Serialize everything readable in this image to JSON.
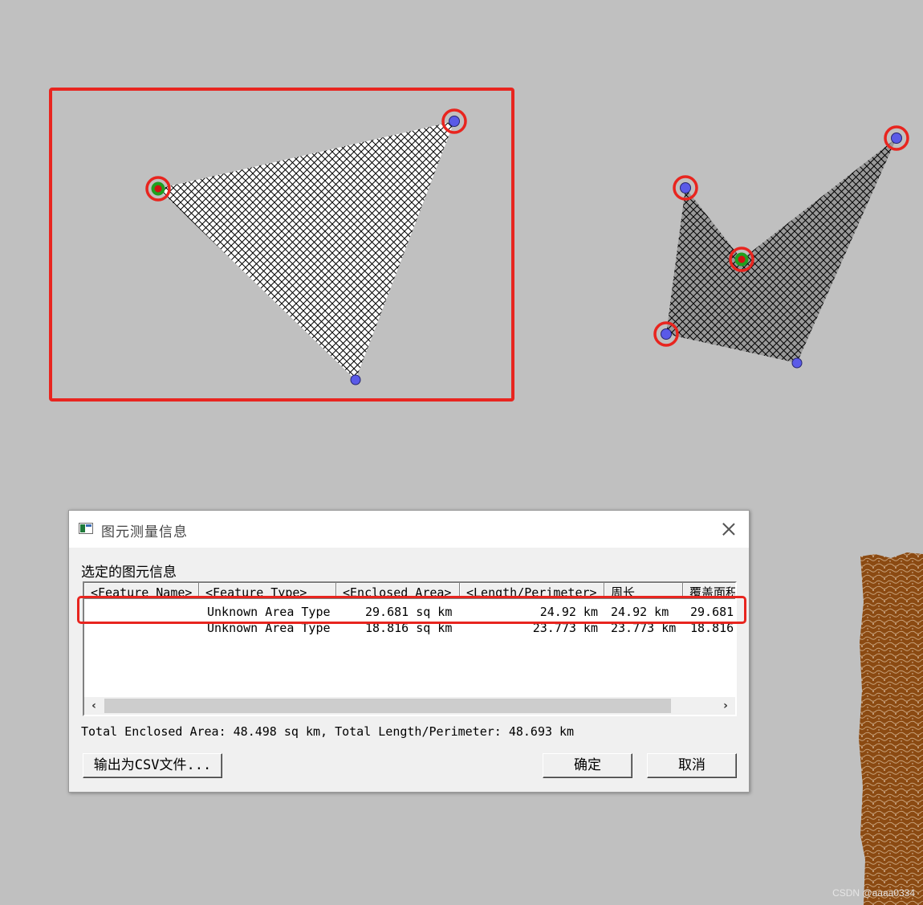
{
  "dialog": {
    "title": "图元测量信息",
    "group_label": "选定的图元信息",
    "columns": [
      "<Feature Name>",
      "<Feature Type>",
      "<Enclosed Area>",
      "<Length/Perimeter>",
      "周长",
      "覆盖面积"
    ],
    "rows": [
      {
        "name": "",
        "type": "Unknown Area Type",
        "area": "29.681 sq km",
        "perimeter": "24.92 km",
        "length": "24.92 km",
        "coverage": "29.681"
      },
      {
        "name": "",
        "type": "Unknown Area Type",
        "area": "18.816 sq km",
        "perimeter": "23.773 km",
        "length": "23.773 km",
        "coverage": "18.816"
      }
    ],
    "selected_row": 0,
    "totals": "Total Enclosed Area: 48.498 sq km, Total Length/Perimeter: 48.693 km",
    "buttons": {
      "export": "输出为CSV文件...",
      "ok": "确定",
      "cancel": "取消"
    }
  },
  "icons": {
    "close": "close-icon",
    "scroll_left": "chevron-left-icon",
    "scroll_right": "chevron-right-icon",
    "app": "map-window-icon",
    "vertex": "vertex-dot-icon",
    "selected_vertex": "selected-vertex-icon"
  },
  "watermark": "CSDN @aaaa0334",
  "colors": {
    "background": "#c0c0c0",
    "highlight_red": "#e8251f",
    "vertex_blue": "#5a5ae8",
    "vertex_green": "#1fa01f",
    "terrain_brown": "#8b4a12"
  }
}
